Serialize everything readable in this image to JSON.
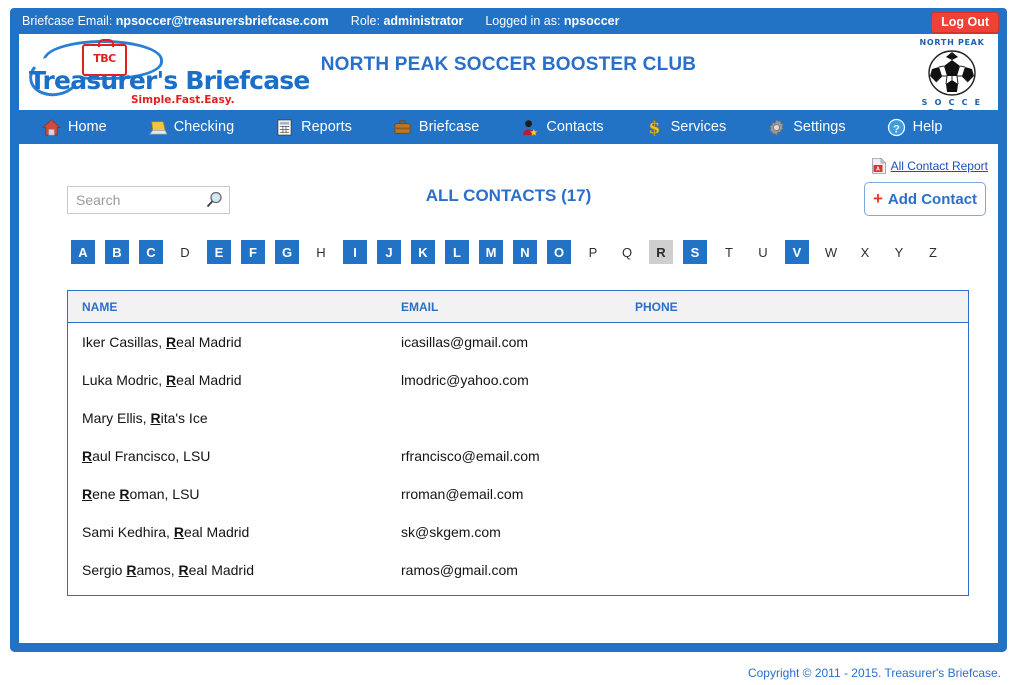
{
  "topbar": {
    "email_label": "Briefcase Email:",
    "email_value": "npsoccer@treasurersbriefcase.com",
    "role_label": "Role:",
    "role_value": "administrator",
    "login_label": "Logged in as:",
    "login_value": "npsoccer",
    "logout_label": "Log Out"
  },
  "brand": {
    "mark": "TBC",
    "name": "Treasurer's Briefcase",
    "tagline": "Simple.Fast.Easy."
  },
  "club": {
    "title": "NORTH PEAK SOCCER BOOSTER CLUB",
    "logo_top": "NORTH PEAK",
    "logo_bottom": "S O C C E R"
  },
  "nav": [
    {
      "label": "Home",
      "icon": "house-icon"
    },
    {
      "label": "Checking",
      "icon": "laptop-icon"
    },
    {
      "label": "Reports",
      "icon": "spreadsheet-icon"
    },
    {
      "label": "Briefcase",
      "icon": "briefcase-icon"
    },
    {
      "label": "Contacts",
      "icon": "person-star-icon"
    },
    {
      "label": "Services",
      "icon": "dollar-icon"
    },
    {
      "label": "Settings",
      "icon": "gear-icon"
    },
    {
      "label": "Help",
      "icon": "question-circle-icon"
    }
  ],
  "report_link": {
    "label": "All Contact Report",
    "icon": "pdf-icon"
  },
  "search": {
    "value": "",
    "placeholder": "Search",
    "icon": "magnifier-icon"
  },
  "page_title": "ALL CONTACTS (17)",
  "add_contact": {
    "plus": "+",
    "label": "Add Contact"
  },
  "alphabet": [
    {
      "letter": "A",
      "state": "active"
    },
    {
      "letter": "B",
      "state": "active"
    },
    {
      "letter": "C",
      "state": "active"
    },
    {
      "letter": "D",
      "state": "disabled"
    },
    {
      "letter": "E",
      "state": "active"
    },
    {
      "letter": "F",
      "state": "active"
    },
    {
      "letter": "G",
      "state": "active"
    },
    {
      "letter": "H",
      "state": "disabled"
    },
    {
      "letter": "I",
      "state": "active"
    },
    {
      "letter": "J",
      "state": "active"
    },
    {
      "letter": "K",
      "state": "active"
    },
    {
      "letter": "L",
      "state": "active"
    },
    {
      "letter": "M",
      "state": "active"
    },
    {
      "letter": "N",
      "state": "active"
    },
    {
      "letter": "O",
      "state": "active"
    },
    {
      "letter": "P",
      "state": "disabled"
    },
    {
      "letter": "Q",
      "state": "disabled"
    },
    {
      "letter": "R",
      "state": "selected"
    },
    {
      "letter": "S",
      "state": "active"
    },
    {
      "letter": "T",
      "state": "disabled"
    },
    {
      "letter": "U",
      "state": "disabled"
    },
    {
      "letter": "V",
      "state": "active"
    },
    {
      "letter": "W",
      "state": "disabled"
    },
    {
      "letter": "X",
      "state": "disabled"
    },
    {
      "letter": "Y",
      "state": "disabled"
    },
    {
      "letter": "Z",
      "state": "disabled"
    }
  ],
  "table": {
    "columns": [
      "NAME",
      "EMAIL",
      "PHONE"
    ],
    "rows": [
      {
        "name_parts": [
          {
            "t": "Iker Casillas, ",
            "b": false
          },
          {
            "t": "R",
            "b": true
          },
          {
            "t": "eal Madrid",
            "b": false
          }
        ],
        "name": "Iker Casillas, Real Madrid",
        "email": "icasillas@gmail.com",
        "phone": ""
      },
      {
        "name_parts": [
          {
            "t": "Luka Modric, ",
            "b": false
          },
          {
            "t": "R",
            "b": true
          },
          {
            "t": "eal Madrid",
            "b": false
          }
        ],
        "name": "Luka Modric, Real Madrid",
        "email": "lmodric@yahoo.com",
        "phone": ""
      },
      {
        "name_parts": [
          {
            "t": "Mary Ellis, ",
            "b": false
          },
          {
            "t": "R",
            "b": true
          },
          {
            "t": "ita's Ice",
            "b": false
          }
        ],
        "name": "Mary Ellis, Rita's Ice",
        "email": "",
        "phone": ""
      },
      {
        "name_parts": [
          {
            "t": "R",
            "b": true
          },
          {
            "t": "aul Francisco, LSU",
            "b": false
          }
        ],
        "name": "Raul Francisco, LSU",
        "email": "rfrancisco@email.com",
        "phone": ""
      },
      {
        "name_parts": [
          {
            "t": "R",
            "b": true
          },
          {
            "t": "ene ",
            "b": false
          },
          {
            "t": "R",
            "b": true
          },
          {
            "t": "oman, LSU",
            "b": false
          }
        ],
        "name": "Rene Roman, LSU",
        "email": "rroman@email.com",
        "phone": ""
      },
      {
        "name_parts": [
          {
            "t": "Sami Kedhira, ",
            "b": false
          },
          {
            "t": "R",
            "b": true
          },
          {
            "t": "eal Madrid",
            "b": false
          }
        ],
        "name": "Sami Kedhira, Real Madrid",
        "email": "sk@skgem.com",
        "phone": ""
      },
      {
        "name_parts": [
          {
            "t": "Sergio ",
            "b": false
          },
          {
            "t": "R",
            "b": true
          },
          {
            "t": "amos, ",
            "b": false
          },
          {
            "t": "R",
            "b": true
          },
          {
            "t": "eal Madrid",
            "b": false
          }
        ],
        "name": "Sergio Ramos, Real Madrid",
        "email": "ramos@gmail.com",
        "phone": ""
      }
    ]
  },
  "footer": "Copyright © 2011 - 2015. Treasurer's Briefcase.",
  "colors": {
    "brand_blue": "#2272c6",
    "title_blue": "#2a6fc9",
    "logout_red": "#ef4136",
    "plus_red": "#e8392d",
    "selected_gray": "#cfcfcf"
  }
}
